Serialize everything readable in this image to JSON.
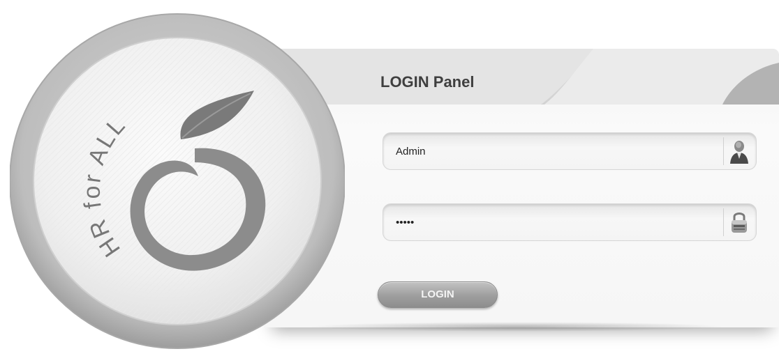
{
  "panel": {
    "title": "LOGIN Panel"
  },
  "logo": {
    "text": "HR for ALL"
  },
  "username": {
    "value": "Admin",
    "icon": "user-icon"
  },
  "password": {
    "value": "admin",
    "icon": "lock-icon"
  },
  "login_button": {
    "label": "LOGIN"
  }
}
